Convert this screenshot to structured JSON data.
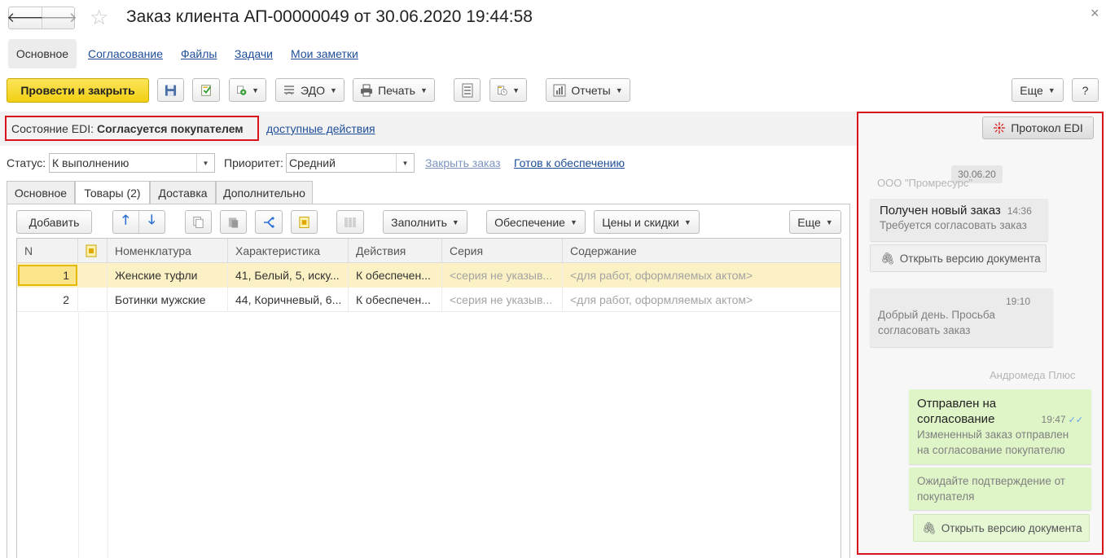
{
  "window": {
    "title": "Заказ клиента АП-00000049 от 30.06.2020 19:44:58",
    "close_glyph": "×"
  },
  "nav_tabs": [
    "Основное",
    "Согласование",
    "Файлы",
    "Задачи",
    "Мои заметки"
  ],
  "toolbar": {
    "post_close_label": "Провести и закрыть",
    "edo_label": "ЭДО",
    "print_label": "Печать",
    "reports_label": "Отчеты",
    "more_label": "Еще",
    "help_label": "?"
  },
  "edi": {
    "state_label": "Состояние EDI:",
    "state_value": "Согласуется покупателем",
    "actions_link": "доступные действия",
    "protocol_label": "Протокол EDI"
  },
  "fields": {
    "status_label": "Статус:",
    "status_value": "К выполнению",
    "priority_label": "Приоритет:",
    "priority_value": "Средний",
    "close_order_link": "Закрыть заказ",
    "ready_link": "Готов к обеспечению"
  },
  "form_tabs": [
    "Основное",
    "Товары (2)",
    "Доставка",
    "Дополнительно"
  ],
  "table_toolbar": {
    "add_label": "Добавить",
    "fill_label": "Заполнить",
    "supply_label": "Обеспечение",
    "prices_label": "Цены и скидки",
    "more_label": "Еще"
  },
  "table": {
    "columns": [
      "N",
      "Номенклатура",
      "Характеристика",
      "Действия",
      "Серия",
      "Содержание"
    ],
    "rows": [
      {
        "n": "1",
        "item": "Женские туфли",
        "spec": "41, Белый, 5, иску...",
        "action": "К обеспечен...",
        "series": "<серия не указыв...",
        "content": "<для работ, оформляемых актом>"
      },
      {
        "n": "2",
        "item": "Ботинки мужские",
        "spec": "44, Коричневый, 6...",
        "action": "К обеспечен...",
        "series": "<серия не указыв...",
        "content": "<для работ, оформляемых актом>"
      }
    ]
  },
  "chat": {
    "date": "30.06.20",
    "sender_left": "ООО \"Промресурс\"",
    "msg1_title": "Получен новый заказ",
    "msg1_time": "14:36",
    "msg1_text": "Требуется согласовать заказ",
    "open_version": "Открыть версию документа",
    "msg2_time": "19:10",
    "msg2_line1": "Добрый день. Просьба",
    "msg2_line2": "согласовать заказ",
    "sender_right": "Андромеда Плюс",
    "msg3_title_line1": "Отправлен на",
    "msg3_title_line2": "согласование",
    "msg3_time": "19:47",
    "msg3_line1": "Измененный заказ отправлен",
    "msg3_line2": "на согласование покупателю",
    "msg4_line1": "Ожидайте подтверждение от",
    "msg4_line2": "покупателя",
    "open_version_2": "Открыть версию документа"
  },
  "colors": {
    "accent_yellow": "#f6d625",
    "highlight_red": "#d7141a",
    "link_blue": "#1f4e99",
    "selected_row": "#fbf1c4",
    "green_bubble": "#dff5c8"
  }
}
